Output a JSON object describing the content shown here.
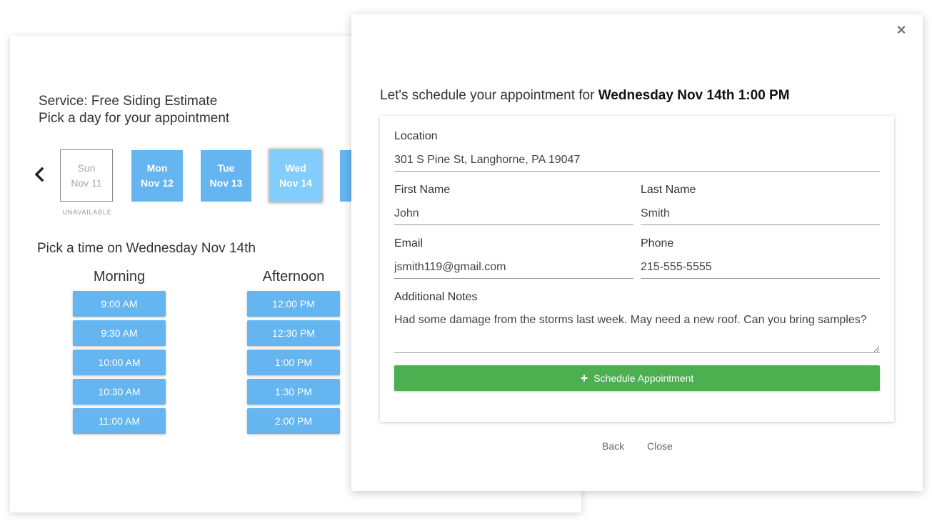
{
  "booking": {
    "service": "Service: Free Siding Estimate",
    "pick_day": "Pick a day for your appointment",
    "days": [
      {
        "dow": "Sun",
        "date": "Nov 11",
        "status": "unavailable"
      },
      {
        "dow": "Mon",
        "date": "Nov 12",
        "status": "available"
      },
      {
        "dow": "Tue",
        "date": "Nov 13",
        "status": "available"
      },
      {
        "dow": "Wed",
        "date": "Nov 14",
        "status": "selected"
      }
    ],
    "unavailable_note": "UNAVAILABLE",
    "pick_time": "Pick a time on Wednesday Nov 14th",
    "morning_label": "Morning",
    "afternoon_label": "Afternoon",
    "morning_slots": [
      "9:00 AM",
      "9:30 AM",
      "10:00 AM",
      "10:30 AM",
      "11:00 AM"
    ],
    "afternoon_slots": [
      "12:00 PM",
      "12:30 PM",
      "1:00 PM",
      "1:30 PM",
      "2:00 PM"
    ]
  },
  "modal": {
    "close_symbol": "×",
    "title_prefix": "Let's schedule your appointment for",
    "title_datetime": "Wednesday Nov 14th 1:00 PM",
    "location_label": "Location",
    "location_value": "301 S Pine St, Langhorne, PA 19047",
    "first_name_label": "First Name",
    "first_name_value": "John",
    "last_name_label": "Last Name",
    "last_name_value": "Smith",
    "email_label": "Email",
    "email_value": "jsmith119@gmail.com",
    "phone_label": "Phone",
    "phone_value": "215-555-5555",
    "notes_label": "Additional Notes",
    "notes_value": "Had some damage from the storms last week. May need a new roof. Can you bring samples?",
    "submit_label": "Schedule Appointment",
    "back_label": "Back",
    "close_label": "Close"
  },
  "colors": {
    "slot_blue": "#64b5f0",
    "selected_blue": "#82cdfb",
    "submit_green": "#4caf50"
  }
}
